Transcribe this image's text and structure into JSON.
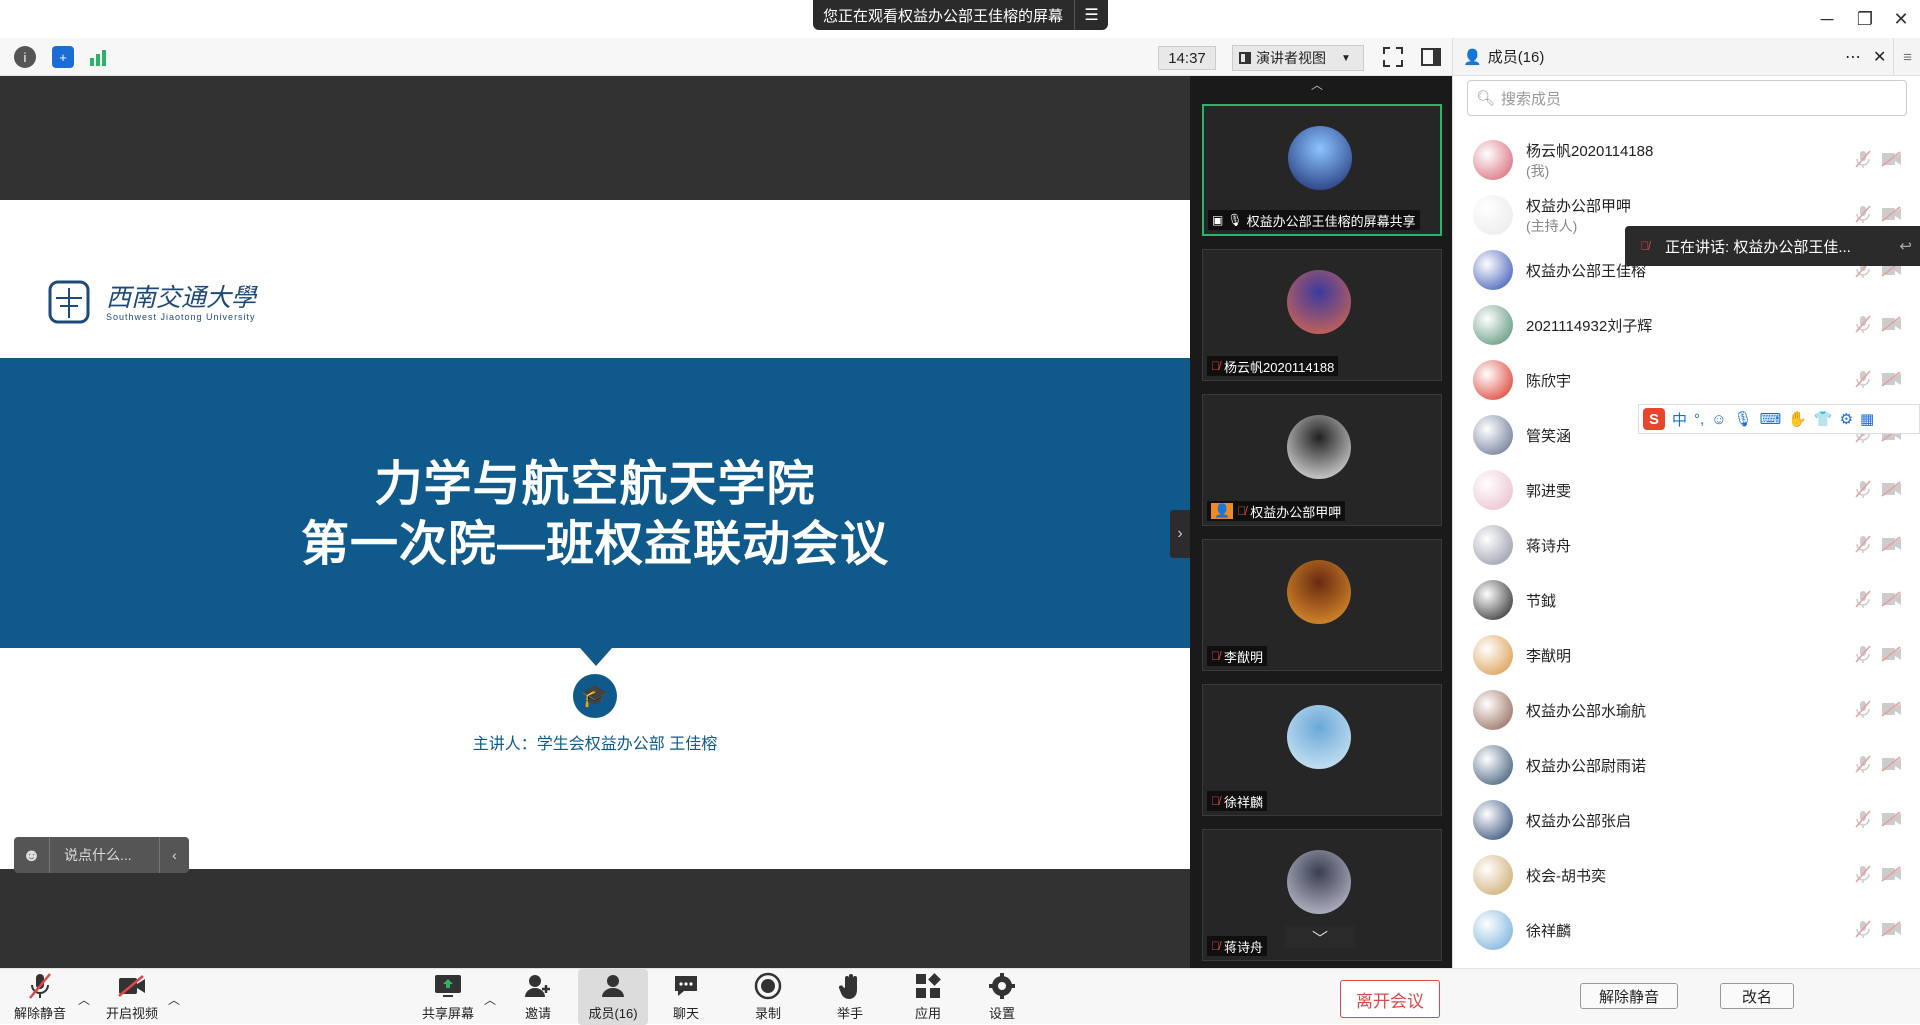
{
  "banner": {
    "text": "您正在观看权益办公部王佳榕的屏幕"
  },
  "toolbar": {
    "clock": "14:37",
    "view_mode": "演讲者视图"
  },
  "slide": {
    "logo_text": "西南交通大學",
    "logo_subtitle": "Southwest Jiaotong University",
    "title_line1": "力学与航空航天学院",
    "title_line2": "第一次院—班权益联动会议",
    "presenter": "主讲人：学生会权益办公部 王佳榕"
  },
  "chat": {
    "placeholder": "说点什么..."
  },
  "gallery": [
    {
      "name": "权益办公部王佳榕的屏幕共享",
      "color1": "#1a2a6e",
      "color2": "#8ac4ff"
    },
    {
      "name": "杨云帆2020114188",
      "color1": "#e06a4a",
      "color2": "#3a3aa0"
    },
    {
      "name": "权益办公部甲呷",
      "color1": "#f0f0f0",
      "color2": "#222222"
    },
    {
      "name": "李猷明",
      "color1": "#e89a30",
      "color2": "#6a2a10"
    },
    {
      "name": "徐祥麟",
      "color1": "#d8ecf6",
      "color2": "#6aa8d8"
    },
    {
      "name": "蒋诗舟",
      "color1": "#c8ccd8",
      "color2": "#3a3e52"
    }
  ],
  "members": {
    "title": "成员(16)",
    "search_placeholder": "搜索成员",
    "speaking": "正在讲话: 权益办公部王佳...",
    "list": [
      {
        "name": "杨云帆2020114188",
        "sub": "(我)",
        "color": "#d45a6a"
      },
      {
        "name": "权益办公部甲呷",
        "sub": "(主持人)",
        "color": "#e8e8e8"
      },
      {
        "name": "权益办公部王佳榕",
        "sub": "",
        "color": "#2a4ab0"
      },
      {
        "name": "2021114932刘子辉",
        "sub": "",
        "color": "#4a8a6a"
      },
      {
        "name": "陈欣宇",
        "sub": "",
        "color": "#d82a1a"
      },
      {
        "name": "管笑涵",
        "sub": "",
        "color": "#5a6a8a"
      },
      {
        "name": "郭进雯",
        "sub": "",
        "color": "#e8b8c8"
      },
      {
        "name": "蒋诗舟",
        "sub": "",
        "color": "#8a8ea0"
      },
      {
        "name": "节鉞",
        "sub": "",
        "color": "#1a1a1a"
      },
      {
        "name": "李猷明",
        "sub": "",
        "color": "#d8903a"
      },
      {
        "name": "权益办公部水瑜航",
        "sub": "",
        "color": "#8a5a4a"
      },
      {
        "name": "权益办公部尉雨诺",
        "sub": "",
        "color": "#2a4a6a"
      },
      {
        "name": "权益办公部张启",
        "sub": "",
        "color": "#1a3a6a"
      },
      {
        "name": "校会-胡书奕",
        "sub": "",
        "color": "#c8a060"
      },
      {
        "name": "徐祥麟",
        "sub": "",
        "color": "#6aa8d8"
      }
    ],
    "unmute_btn": "解除静音",
    "rename_btn": "改名"
  },
  "bottom": {
    "unmute": "解除静音",
    "video": "开启视频",
    "share": "共享屏幕",
    "invite": "邀请",
    "members": "成员(16)",
    "chat": "聊天",
    "record": "录制",
    "raise_hand": "举手",
    "apps": "应用",
    "settings": "设置",
    "leave": "离开会议"
  },
  "ime": {
    "lang": "中",
    "punct": "°,"
  },
  "colors": {
    "accent_red": "#e04848",
    "slide_blue": "#0f5a8a",
    "active_green": "#2fb36b"
  }
}
